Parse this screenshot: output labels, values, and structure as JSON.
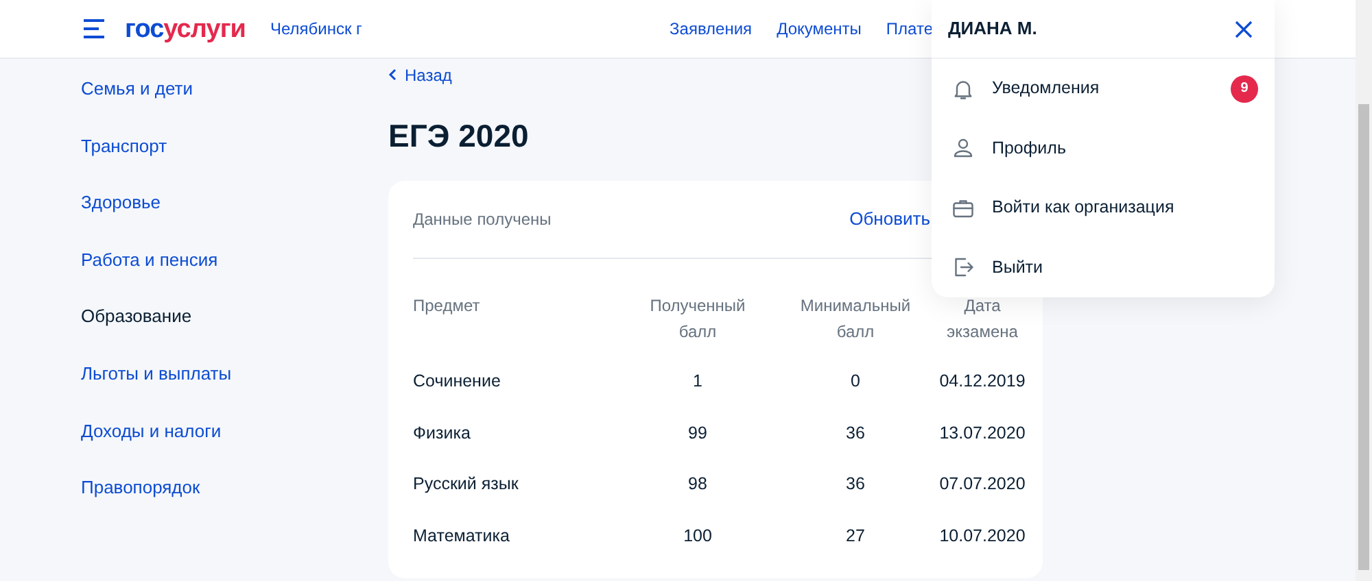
{
  "header": {
    "logo_left": "гос",
    "logo_right": "услуги",
    "city": "Челябинск г",
    "nav": [
      "Заявления",
      "Документы",
      "Плате"
    ]
  },
  "sidebar": {
    "items": [
      {
        "label": "Семья и дети",
        "selected": false
      },
      {
        "label": "Транспорт",
        "selected": false
      },
      {
        "label": "Здоровье",
        "selected": false
      },
      {
        "label": "Работа и пенсия",
        "selected": false
      },
      {
        "label": "Образование",
        "selected": true
      },
      {
        "label": "Льготы и выплаты",
        "selected": false
      },
      {
        "label": "Доходы и налоги",
        "selected": false
      },
      {
        "label": "Правопорядок",
        "selected": false
      }
    ]
  },
  "back": "Назад",
  "title": "ЕГЭ 2020",
  "card": {
    "status": "Данные получены",
    "refresh": "Обновить",
    "columns": [
      "Предмет",
      "Полученный балл",
      "Минимальный балл",
      "Дата экзамена"
    ],
    "rows": [
      [
        "Сочинение",
        "1",
        "0",
        "04.12.2019"
      ],
      [
        "Физика",
        "99",
        "36",
        "13.07.2020"
      ],
      [
        "Русский язык",
        "98",
        "36",
        "07.07.2020"
      ],
      [
        "Математика",
        "100",
        "27",
        "10.07.2020"
      ]
    ]
  },
  "menu": {
    "user": "ДИАНА М.",
    "items": [
      {
        "kind": "bell",
        "label": "Уведомления",
        "badge": "9"
      },
      {
        "kind": "person",
        "label": "Профиль"
      },
      {
        "kind": "briefcase",
        "label": "Войти как организация"
      },
      {
        "kind": "exit",
        "label": "Выйти"
      }
    ]
  }
}
